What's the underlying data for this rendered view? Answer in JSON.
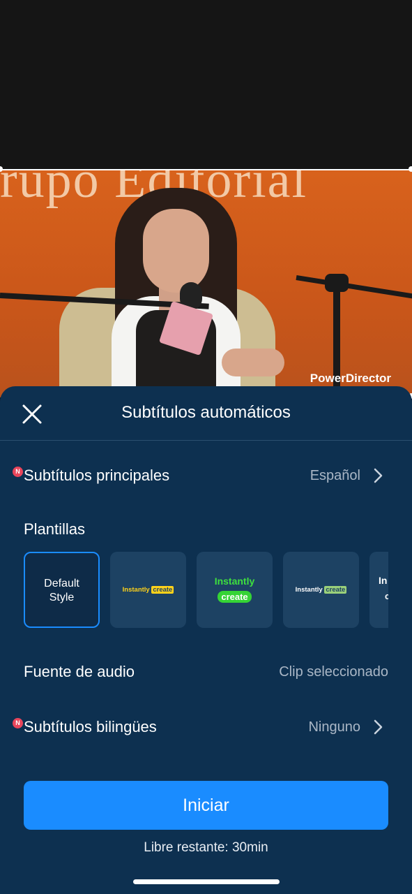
{
  "preview": {
    "watermark": "PowerDirector",
    "background_sign_text": "rupo Editorial"
  },
  "sheet": {
    "title": "Subtítulos automáticos",
    "close_icon": "close-icon",
    "main_subtitles": {
      "badge": "N",
      "label": "Subtítulos principales",
      "value": "Español"
    },
    "templates": {
      "label": "Plantillas",
      "items": [
        {
          "kind": "default",
          "line1": "Default",
          "line2": "Style",
          "selected": true
        },
        {
          "kind": "highlight",
          "word1": "Instantly",
          "word2": "create",
          "color1": "#ffd21a",
          "hl_bg": "#ffd21a",
          "hl_fg": "#1d4263"
        },
        {
          "kind": "stacked",
          "word1": "Instantly",
          "word2": "create",
          "color1": "#3ee03e",
          "hl_bg": "#35d435",
          "hl_fg": "#ffffff"
        },
        {
          "kind": "highlight",
          "word1": "Instantly",
          "word2": "create",
          "color1": "#ffffff",
          "hl_bg": "#9ad07a",
          "hl_fg": "#1d4263"
        },
        {
          "kind": "partial",
          "word1": "In",
          "word2": "c"
        }
      ]
    },
    "audio_source": {
      "label": "Fuente de audio",
      "value": "Clip seleccionado"
    },
    "bilingual": {
      "badge": "N",
      "label": "Subtítulos bilingües",
      "value": "Ninguno"
    },
    "start_button": "Iniciar",
    "remaining": "Libre restante: 30min"
  },
  "colors": {
    "sheet_bg": "#0d3050",
    "accent": "#1a8cff",
    "badge": "#e8455b"
  }
}
